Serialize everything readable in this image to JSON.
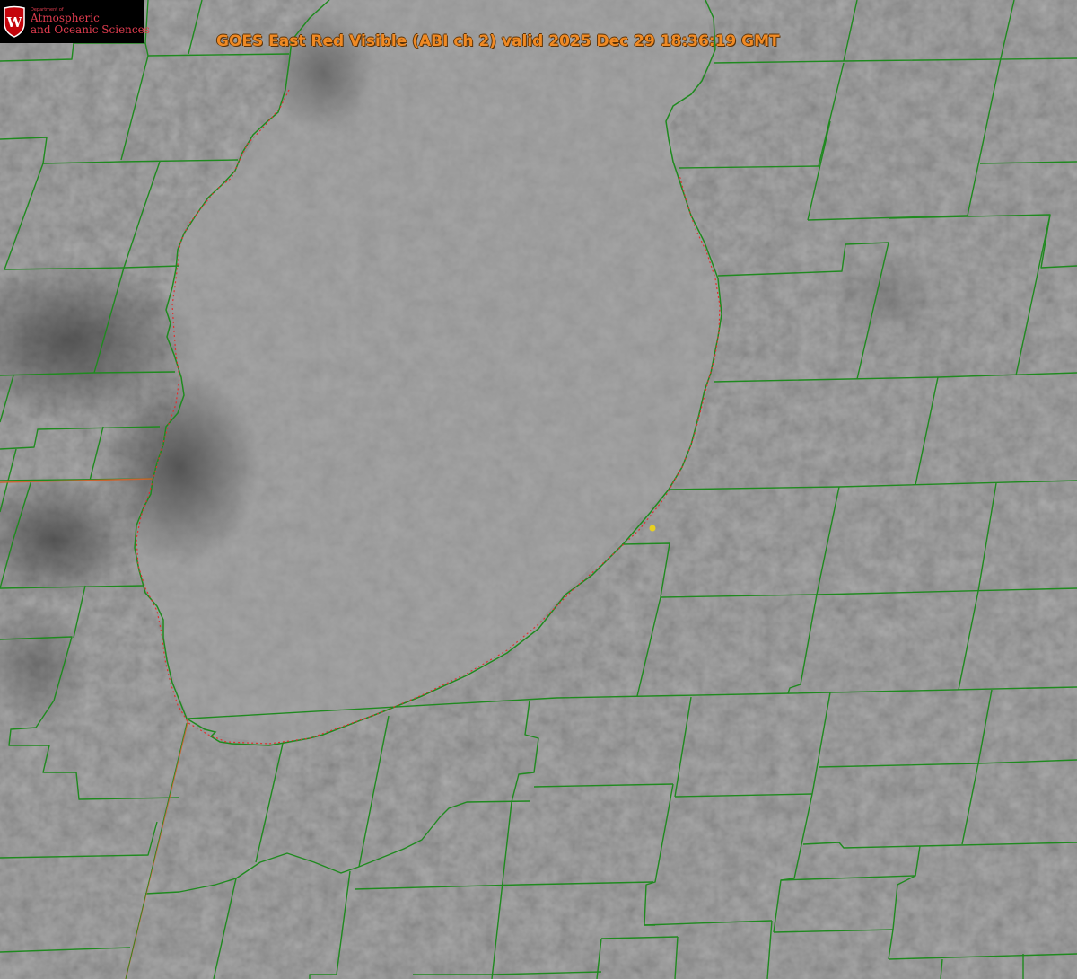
{
  "logo": {
    "department_small": "Department of",
    "line1": "Atmospheric",
    "line2": "and Oceanic Sciences",
    "crest_letter": "W",
    "colors": {
      "box": "#000000",
      "text": "#e03c4f",
      "crest": "#c5050c"
    }
  },
  "title": {
    "text": "GOES East Red Visible (ABI ch 2) valid 2025 Dec 29 18:36:19 GMT",
    "color": "#f08a24"
  },
  "map": {
    "layers": [
      "satellite-imagery",
      "county-boundaries",
      "state-boundaries",
      "shoreline",
      "station-marker"
    ],
    "colors": {
      "county_lines": "#1f8a1f",
      "state_lines": "#c86432",
      "shoreline": "#e03030",
      "station_marker": "#e8d020"
    }
  }
}
